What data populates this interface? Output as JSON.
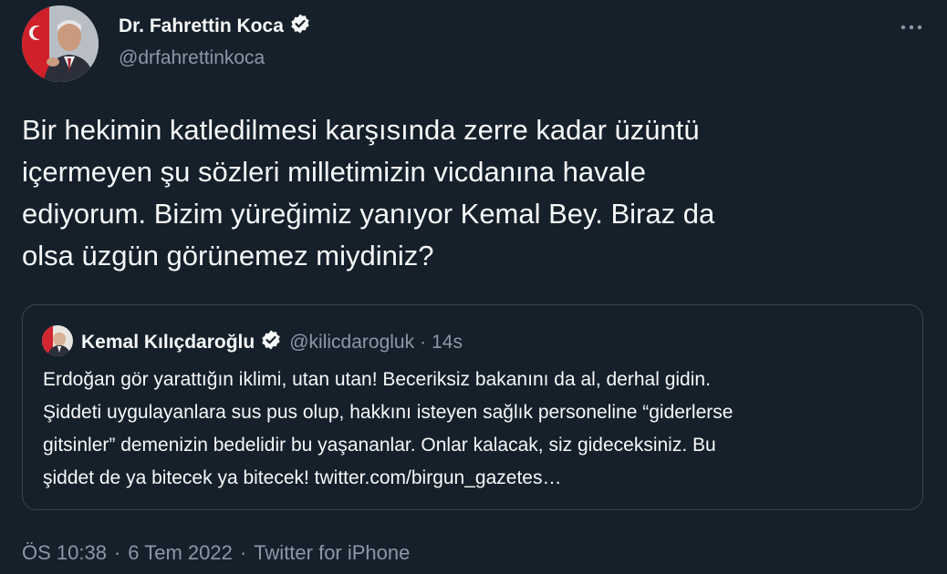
{
  "author": {
    "name": "Dr. Fahrettin Koca",
    "handle": "@drfahrettinkoca",
    "verified": true
  },
  "more_icon": "more-horizontal-icon",
  "tweet": {
    "lines": [
      "Bir hekimin katledilmesi karşısında zerre kadar üzüntü",
      "içermeyen şu sözleri milletimizin vicdanına havale",
      "ediyorum. Bizim yüreğimiz yanıyor Kemal Bey. Biraz da",
      "olsa üzgün görünemez miydiniz?"
    ]
  },
  "quoted": {
    "name": "Kemal Kılıçdaroğlu",
    "handle": "@kilicdarogluk",
    "separator": "·",
    "time": "14s",
    "verified": true,
    "lines": [
      "Erdoğan gör yarattığın iklimi, utan utan! Beceriksiz bakanını da al, derhal gidin.",
      "Şiddeti uygulayanlara sus pus olup, hakkını isteyen sağlık personeline “giderlerse",
      "gitsinler” demenizin bedelidir bu yaşananlar. Onlar kalacak, siz gideceksiniz. Bu",
      "şiddet de ya bitecek ya bitecek! twitter.com/birgun_gazetes…"
    ]
  },
  "meta": {
    "time": "ÖS 10:38",
    "sep": "·",
    "date": "6 Tem 2022",
    "source": "Twitter for iPhone"
  },
  "colors": {
    "background": "#15202b",
    "text": "#f7f9f9",
    "secondary": "#8b98a5",
    "border": "#38444d",
    "verified_badge": "#f7f9f9"
  }
}
